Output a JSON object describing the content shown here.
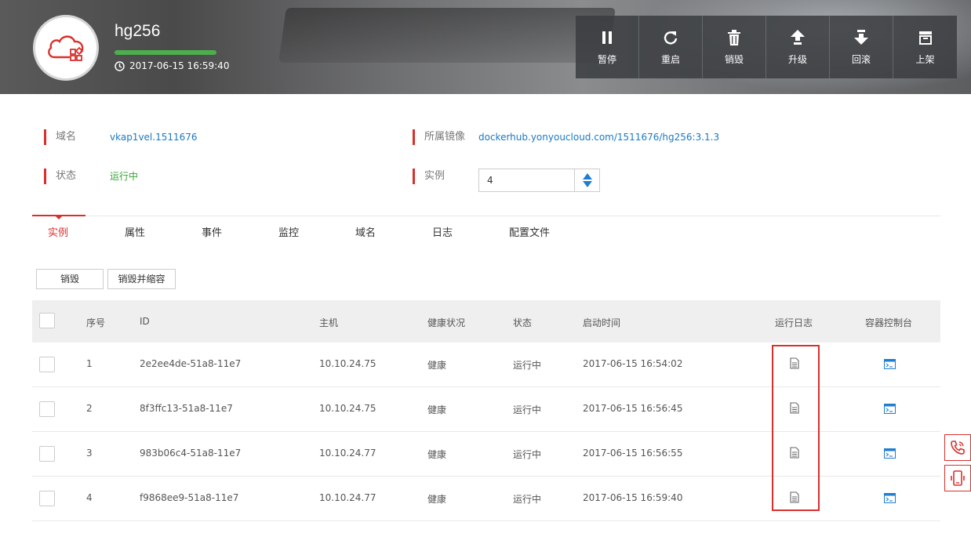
{
  "header": {
    "app_name": "hg256",
    "started_at": "2017-06-15 16:59:40",
    "actions": [
      {
        "label": "暂停",
        "icon": "pause-icon"
      },
      {
        "label": "重启",
        "icon": "restart-icon"
      },
      {
        "label": "销毁",
        "icon": "trash-icon"
      },
      {
        "label": "升级",
        "icon": "upgrade-icon"
      },
      {
        "label": "回滚",
        "icon": "rollback-icon"
      },
      {
        "label": "上架",
        "icon": "shelf-icon"
      }
    ]
  },
  "info": {
    "domain_label": "域名",
    "domain_value": "vkap1vel.1511676",
    "image_label": "所属镜像",
    "image_value": "dockerhub.yonyoucloud.com/1511676/hg256:3.1.3",
    "status_label": "状态",
    "status_value": "运行中",
    "instances_label": "实例",
    "instances_value": "4"
  },
  "tabs": [
    "实例",
    "属性",
    "事件",
    "监控",
    "域名",
    "日志",
    "配置文件"
  ],
  "active_tab": "实例",
  "buttons": {
    "destroy": "销毁",
    "destroy_scale": "销毁并缩容"
  },
  "table": {
    "headers": {
      "index": "序号",
      "id": "ID",
      "host": "主机",
      "health": "健康状况",
      "status": "状态",
      "start_time": "启动时间",
      "log": "运行日志",
      "console": "容器控制台"
    },
    "rows": [
      {
        "index": "1",
        "id": "2e2ee4de-51a8-11e7",
        "host": "10.10.24.75",
        "health": "健康",
        "status": "运行中",
        "start_time": "2017-06-15 16:54:02"
      },
      {
        "index": "2",
        "id": "8f3ffc13-51a8-11e7",
        "host": "10.10.24.75",
        "health": "健康",
        "status": "运行中",
        "start_time": "2017-06-15 16:56:45"
      },
      {
        "index": "3",
        "id": "983b06c4-51a8-11e7",
        "host": "10.10.24.77",
        "health": "健康",
        "status": "运行中",
        "start_time": "2017-06-15 16:56:55"
      },
      {
        "index": "4",
        "id": "f9868ee9-51a8-11e7",
        "host": "10.10.24.77",
        "health": "健康",
        "status": "运行中",
        "start_time": "2017-06-15 16:59:40"
      }
    ]
  },
  "colors": {
    "accent_red": "#d9302c",
    "link_blue": "#1a79c5",
    "running_green": "#35a635"
  }
}
